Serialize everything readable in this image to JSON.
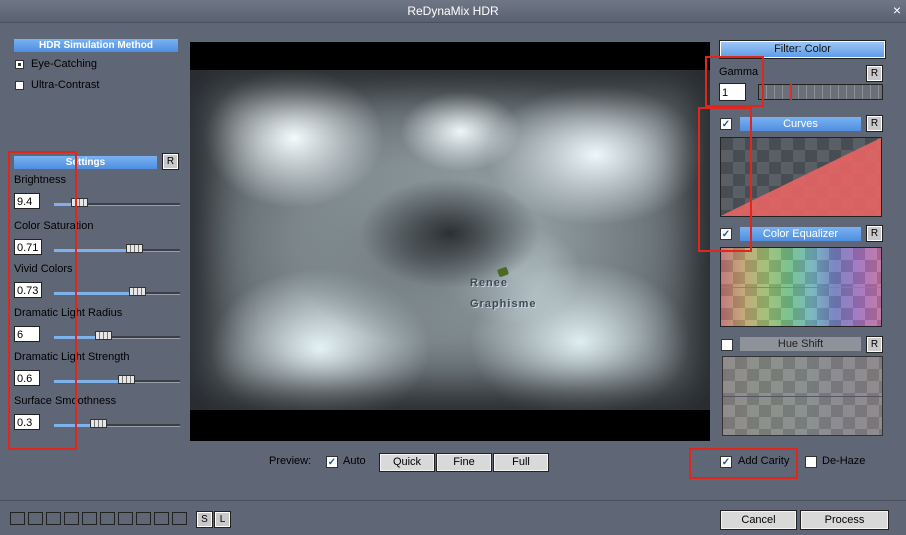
{
  "window": {
    "title": "ReDynaMix HDR",
    "close_glyph": "×"
  },
  "method": {
    "header": "HDR Simulation Method",
    "options": [
      {
        "label": "Eye-Catching",
        "selected": true
      },
      {
        "label": "Ultra-Contrast",
        "selected": false
      }
    ]
  },
  "settings": {
    "header": "Settings",
    "reset_label": "R",
    "sliders": [
      {
        "label": "Brightness",
        "value": "9.4",
        "fraction": 0.16
      },
      {
        "label": "Color Saturation",
        "value": "0.71",
        "fraction": 0.66
      },
      {
        "label": "Vivid Colors",
        "value": "0.73",
        "fraction": 0.69
      },
      {
        "label": "Dramatic Light Radius",
        "value": "6",
        "fraction": 0.38
      },
      {
        "label": "Dramatic Light Strength",
        "value": "0.6",
        "fraction": 0.59
      },
      {
        "label": "Surface Smoothness",
        "value": "0.3",
        "fraction": 0.33
      }
    ]
  },
  "preview_image": {
    "watermark_line1": "Renee",
    "watermark_line2": "Graphisme"
  },
  "preview_controls": {
    "label": "Preview:",
    "auto_label": "Auto",
    "auto_checked": true,
    "buttons": [
      "Quick",
      "Fine",
      "Full"
    ]
  },
  "filter": {
    "header": "Filter: Color",
    "gamma_label": "Gamma",
    "gamma_value": "1",
    "curves": {
      "label": "Curves",
      "checked": true
    },
    "color_equalizer": {
      "label": "Color Equalizer",
      "checked": true
    },
    "hue_shift": {
      "label": "Hue Shift",
      "checked": false
    },
    "reset_label": "R"
  },
  "options": {
    "add_clarity": {
      "label": "Add Carity",
      "checked": true
    },
    "de_haze": {
      "label": "De-Haze",
      "checked": false
    }
  },
  "footer": {
    "slot_count": 10,
    "save_label": "S",
    "load_label": "L",
    "cancel_label": "Cancel",
    "process_label": "Process"
  },
  "colors": {
    "background": "#5f6776",
    "header_blue": "#4f8fe0",
    "highlight_red": "#e0261d"
  }
}
